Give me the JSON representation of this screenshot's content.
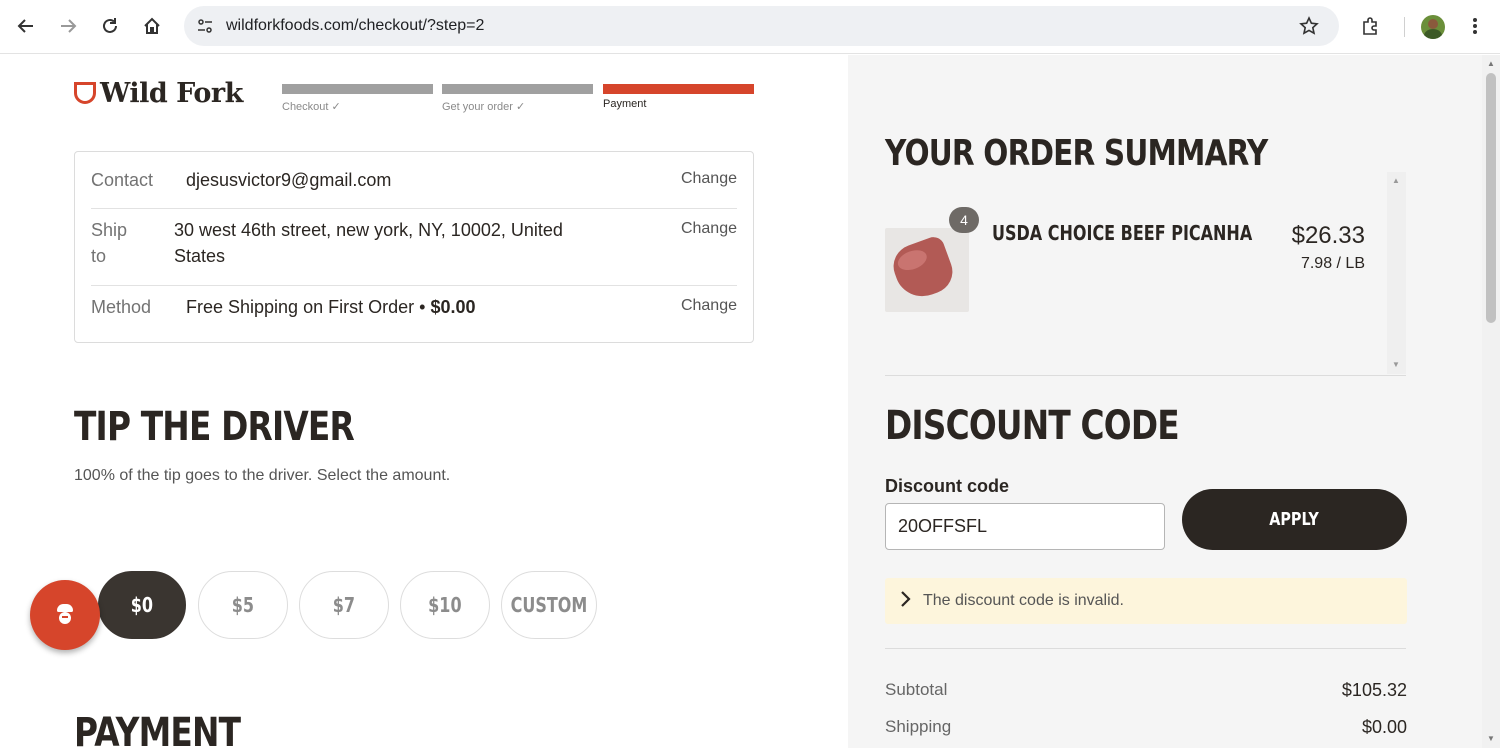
{
  "browser": {
    "url": "wildforkfoods.com/checkout/?step=2"
  },
  "brand": {
    "name": "Wild Fork",
    "accent_color": "#d6452b"
  },
  "steps": [
    {
      "label": "Checkout ✓",
      "active": false
    },
    {
      "label": "Get your order ✓",
      "active": false
    },
    {
      "label": "Payment",
      "active": true
    }
  ],
  "info": {
    "contact": {
      "label": "Contact",
      "value": "djesusvictor9@gmail.com",
      "action": "Change"
    },
    "ship": {
      "label_line1": "Ship",
      "label_line2": "to",
      "value_line1": "30 west 46th street, new york, NY, 10002, United",
      "value_line2": "States",
      "action": "Change"
    },
    "method": {
      "label": "Method",
      "value": "Free Shipping on First Order",
      "separator": "•",
      "price": "$0.00",
      "action": "Change"
    }
  },
  "tip": {
    "title": "TIP THE DRIVER",
    "description": "100% of the tip goes to the driver. Select the amount.",
    "options": [
      "$0",
      "$5",
      "$7",
      "$10",
      "CUSTOM"
    ],
    "selected": "$0"
  },
  "payment": {
    "title": "PAYMENT"
  },
  "summary": {
    "title": "YOUR ORDER SUMMARY",
    "item": {
      "quantity": "4",
      "name": "USDA CHOICE BEEF PICANHA",
      "price": "$26.33",
      "unit_price": "7.98 / LB"
    }
  },
  "discount": {
    "title": "DISCOUNT CODE",
    "label": "Discount code",
    "value": "20OFFSFL",
    "apply_label": "APPLY",
    "error": "The discount code is invalid."
  },
  "totals": {
    "subtotal_label": "Subtotal",
    "subtotal_value": "$105.32",
    "shipping_label": "Shipping",
    "shipping_value": "$0.00"
  }
}
